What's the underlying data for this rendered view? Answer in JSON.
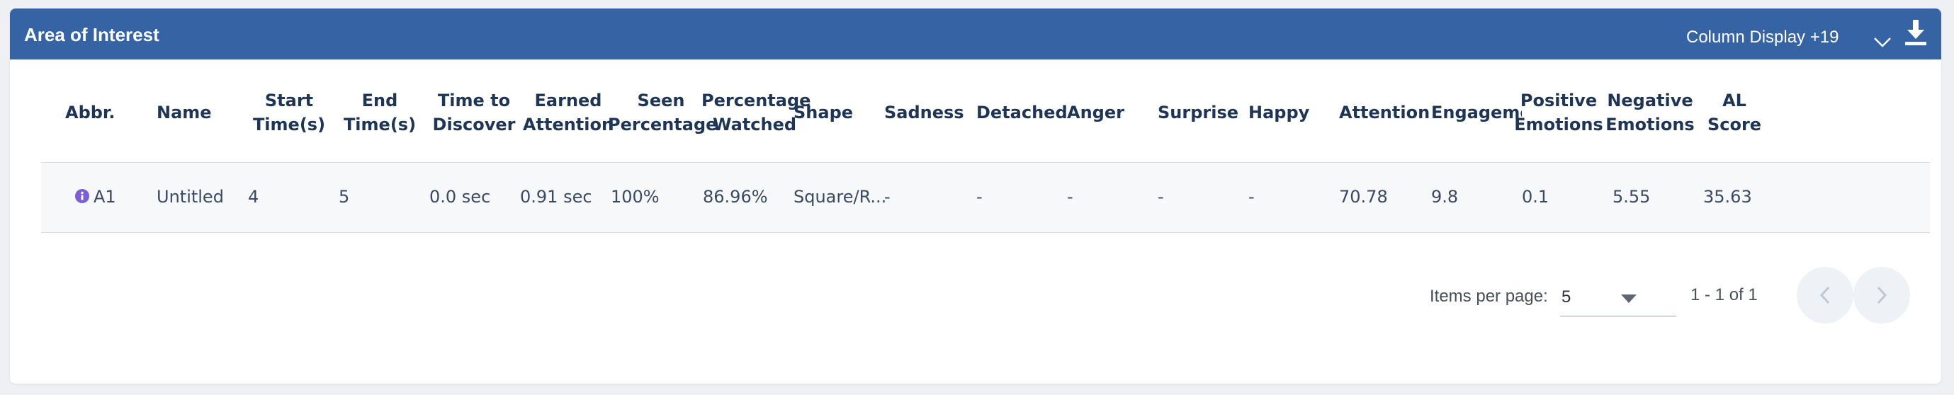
{
  "header": {
    "title": "Area of Interest",
    "column_display": "Column Display +19"
  },
  "table": {
    "columns": [
      {
        "line1": "Abbr.",
        "line2": ""
      },
      {
        "line1": "Name",
        "line2": ""
      },
      {
        "line1": "Start",
        "line2": "Time(s)"
      },
      {
        "line1": "End",
        "line2": "Time(s)"
      },
      {
        "line1": "Time to",
        "line2": "Discover"
      },
      {
        "line1": "Earned",
        "line2": "Attention"
      },
      {
        "line1": "Seen",
        "line2": "Percentage"
      },
      {
        "line1": "Percentage",
        "line2": "Watched"
      },
      {
        "line1": "Shape",
        "line2": ""
      },
      {
        "line1": "Sadness",
        "line2": ""
      },
      {
        "line1": "Detached",
        "line2": ""
      },
      {
        "line1": "Anger",
        "line2": ""
      },
      {
        "line1": "Surprise",
        "line2": ""
      },
      {
        "line1": "Happy",
        "line2": ""
      },
      {
        "line1": "Attention",
        "line2": ""
      },
      {
        "line1": "Engagemer",
        "line2": ""
      },
      {
        "line1": "Positive",
        "line2": "Emotions"
      },
      {
        "line1": "Negative",
        "line2": "Emotions"
      },
      {
        "line1": "AL",
        "line2": "Score"
      }
    ],
    "rows": [
      {
        "cells": [
          "A1",
          "Untitled",
          "4",
          "5",
          "0.0 sec",
          "0.91 sec",
          "100%",
          "86.96%",
          "Square/R...",
          "-",
          "-",
          "-",
          "-",
          "-",
          "70.78",
          "9.8",
          "0.1",
          "5.55",
          "35.63"
        ]
      }
    ]
  },
  "pagination": {
    "items_per_page_label": "Items per page:",
    "items_per_page_value": "5",
    "range_label": "1 - 1 of 1"
  },
  "icons": {
    "info": "info-circle-icon",
    "chevron": "chevron-down-icon",
    "download": "download-icon",
    "prev": "chevron-left-icon",
    "next": "chevron-right-icon"
  },
  "colors": {
    "header_bg": "#3563a4",
    "info_icon": "#7b5fd6"
  }
}
